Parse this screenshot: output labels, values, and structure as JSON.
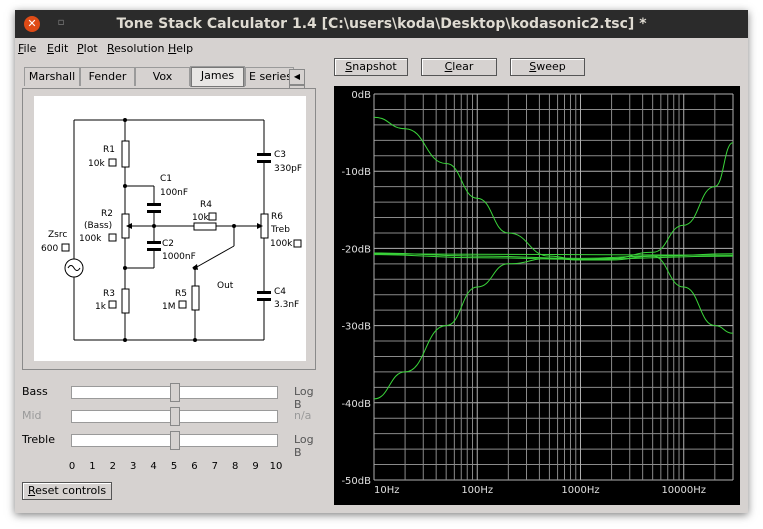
{
  "window": {
    "title": "Tone Stack Calculator 1.4 [C:\\users\\koda\\Desktop\\kodasonic2.tsc] *",
    "close_glyph": "✕",
    "min_glyph": "▫"
  },
  "menu": [
    {
      "first": "F",
      "rest": "ile"
    },
    {
      "first": "E",
      "rest": "dit"
    },
    {
      "first": "P",
      "rest": "lot"
    },
    {
      "first": "R",
      "rest": "esolution"
    },
    {
      "first": "H",
      "rest": "elp"
    }
  ],
  "tabs": [
    "Marshall",
    "Fender",
    "Vox",
    "James",
    "E series"
  ],
  "active_tab": "James",
  "tab_scroll": {
    "left": "◀",
    "right": "▶"
  },
  "schematic": {
    "r1": "R1",
    "r1_val": "10k",
    "c1": "C1",
    "c1_val": "100nF",
    "r2": "R2",
    "r2_sub": "(Bass)",
    "r2_val": "100k",
    "c2": "C2",
    "c2_val": "1000nF",
    "r4": "R4",
    "r4_val": "10k",
    "r6": "R6",
    "r6_sub": "Treb",
    "r6_val": "100k",
    "c3": "C3",
    "c3_val": "330pF",
    "c4": "C4",
    "c4_val": "3.3nF",
    "r3": "R3",
    "r3_val": "1k",
    "r5": "R5",
    "r5_val": "1M",
    "zsrc": "Zsrc",
    "zsrc_val": "600",
    "out": "Out"
  },
  "controls": [
    {
      "label": "Bass",
      "value": 5,
      "right": "Log B",
      "enabled": true
    },
    {
      "label": "Mid",
      "value": 5,
      "right": "n/a",
      "enabled": false
    },
    {
      "label": "Treble",
      "value": 5,
      "right": "Log B",
      "enabled": true
    }
  ],
  "scale": [
    "0",
    "1",
    "2",
    "3",
    "4",
    "5",
    "6",
    "7",
    "8",
    "9",
    "10"
  ],
  "reset": {
    "first": "R",
    "rest": "eset controls"
  },
  "buttons": {
    "snapshot": {
      "first": "S",
      "rest": "napshot"
    },
    "clear": {
      "first": "C",
      "rest": "lear"
    },
    "sweep": {
      "first": "S",
      "rest": "weep"
    }
  },
  "colors": {
    "trace": "#3ad43a",
    "grid": "#8a8a8a",
    "plot_bg": "#000000",
    "window_bg": "#d6d2d0",
    "title_bg": "#2b2b2b",
    "close": "#df4b16"
  },
  "chart_data": {
    "type": "line",
    "x_scale": "log",
    "xlim": [
      10,
      30000
    ],
    "ylim": [
      -50,
      0
    ],
    "x_ticks": [
      "10Hz",
      "100Hz",
      "1000Hz",
      "10000Hz"
    ],
    "y_ticks": [
      "0dB",
      "-10dB",
      "-20dB",
      "-30dB",
      "-40dB",
      "-50dB"
    ],
    "grid": true,
    "series": [
      {
        "x": [
          10,
          20,
          50,
          100,
          200,
          500,
          1000,
          2000,
          5000,
          10000,
          20000,
          30000
        ],
        "values": [
          -3,
          -4.5,
          -9,
          -13.5,
          -18,
          -21,
          -21.5,
          -21.3,
          -20.5,
          -17,
          -12,
          -6.3
        ]
      },
      {
        "x": [
          10,
          20,
          50,
          100,
          200,
          500,
          1000,
          2000,
          5000,
          10000,
          20000,
          30000
        ],
        "values": [
          -39.5,
          -36,
          -30,
          -25,
          -22,
          -21.3,
          -21.5,
          -21.5,
          -21,
          -25,
          -30,
          -31
        ]
      },
      {
        "x": [
          10,
          30000
        ],
        "values": [
          -20.7,
          -20.9
        ]
      },
      {
        "x": [
          10,
          100,
          1000,
          30000
        ],
        "values": [
          -20.8,
          -21.2,
          -21.4,
          -21.0
        ]
      },
      {
        "x": [
          10,
          100,
          1000,
          5000,
          30000
        ],
        "values": [
          -20.6,
          -21.0,
          -21.3,
          -21.0,
          -20.7
        ]
      }
    ]
  }
}
